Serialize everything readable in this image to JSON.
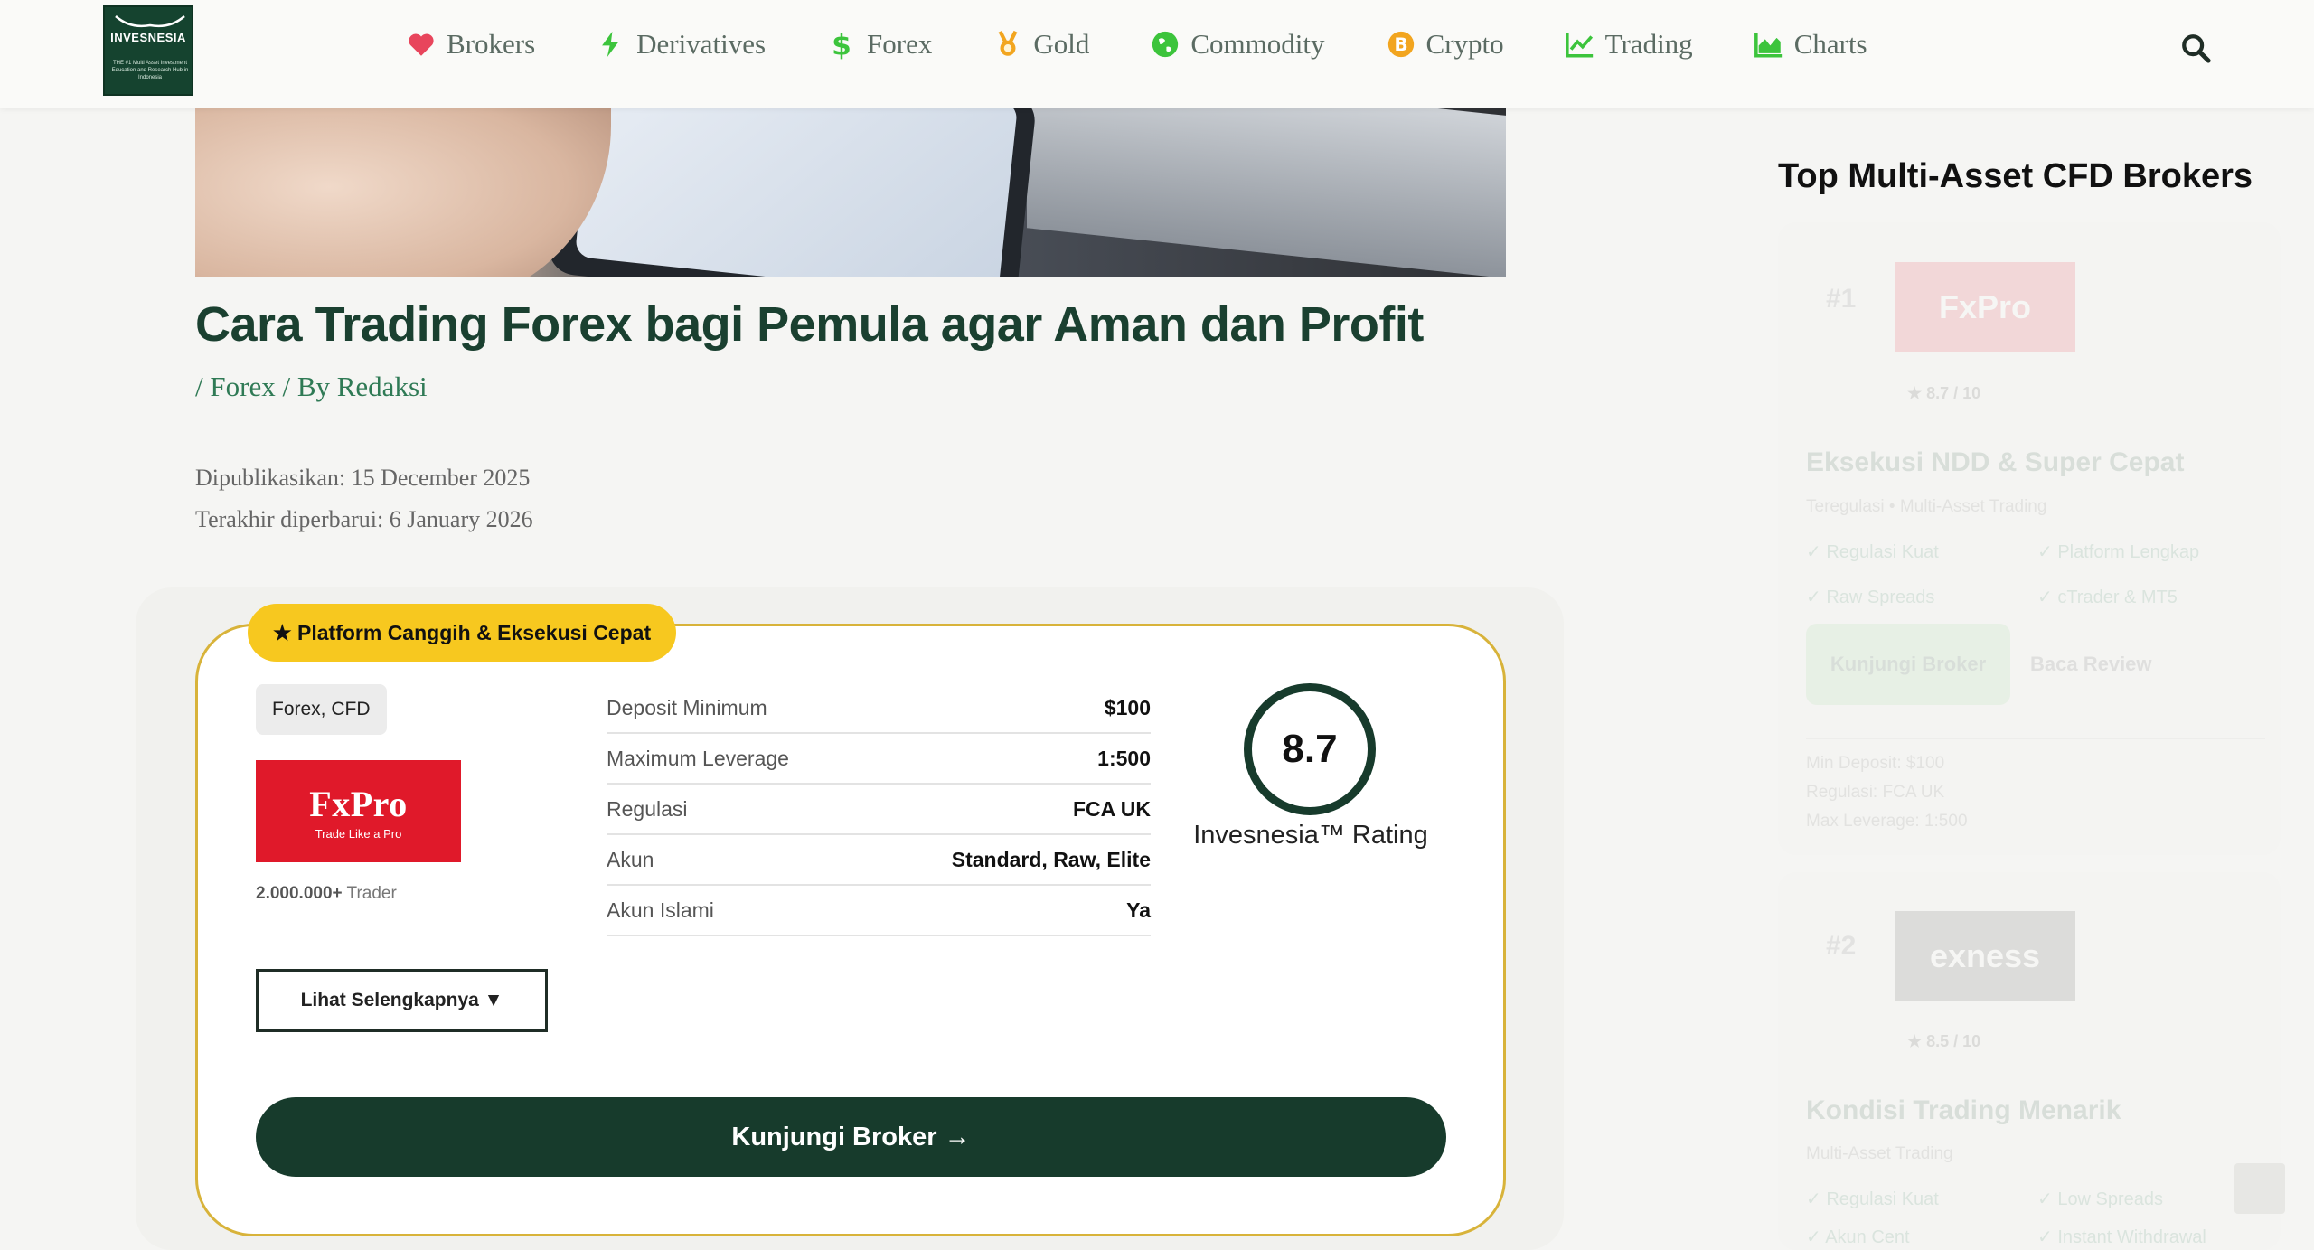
{
  "header": {
    "logo_text": "INVESNESIA",
    "logo_sub": "THE #1 Multi Asset Investment Education and Research Hub in Indonesia",
    "nav": [
      {
        "label": "Brokers",
        "icon": "heart-icon",
        "color": "#e8455c"
      },
      {
        "label": "Derivatives",
        "icon": "bolt-icon",
        "color": "#3cc43c"
      },
      {
        "label": "Forex",
        "icon": "dollar-icon",
        "color": "#3cc43c"
      },
      {
        "label": "Gold",
        "icon": "medal-icon",
        "color": "#f2a51f"
      },
      {
        "label": "Commodity",
        "icon": "globe-icon",
        "color": "#3cc43c"
      },
      {
        "label": "Crypto",
        "icon": "bitcoin-icon",
        "color": "#f2a51f"
      },
      {
        "label": "Trading",
        "icon": "line-chart-icon",
        "color": "#3cc43c"
      },
      {
        "label": "Charts",
        "icon": "area-chart-icon",
        "color": "#3cc43c"
      }
    ]
  },
  "article": {
    "title": "Cara Trading Forex bagi Pemula agar Aman dan Profit",
    "meta_prefix": "/ ",
    "category": "Forex",
    "meta_by": " / By ",
    "author": "Redaksi",
    "published": "Dipublikasikan: 15 December 2025",
    "updated": "Terakhir diperbarui: 6 January 2026"
  },
  "broker_card": {
    "badge": "★ Platform Canggih & Eksekusi Cepat",
    "tag": "Forex, CFD",
    "logo_name": "FxPro",
    "logo_tagline": "Trade Like a Pro",
    "traders_count": "2.000.000+",
    "traders_label": " Trader",
    "more_button": "Lihat Selengkapnya ▼",
    "specs": [
      {
        "label": "Deposit Minimum",
        "value": "$100"
      },
      {
        "label": "Maximum Leverage",
        "value": "1:500"
      },
      {
        "label": "Regulasi",
        "value": "FCA UK"
      },
      {
        "label": "Akun",
        "value": "Standard, Raw, Elite"
      },
      {
        "label": "Akun Islami",
        "value": "Ya"
      }
    ],
    "rating": "8.7",
    "rating_label": "Invesnesia™ Rating",
    "visit_button": "Kunjungi Broker →",
    "accent": "#d8b33a",
    "button_color": "#173b2c"
  },
  "sidebar": {
    "title": "Top Multi-Asset CFD Brokers",
    "brokers": [
      {
        "rank": "#1",
        "logo": "FxPro",
        "score": "★ 8.7 / 10",
        "headline": "Eksekusi NDD & Super Cepat",
        "sub": "Teregulasi • Multi-Asset Trading",
        "features": [
          "✓ Regulasi Kuat",
          "✓ Platform Lengkap",
          "✓ Raw Spreads",
          "✓ cTrader & MT5"
        ],
        "button": "Kunjungi Broker",
        "link": "Baca Review",
        "info": [
          "Min Deposit: $100",
          "Regulasi: FCA UK",
          "Max Leverage: 1:500"
        ]
      },
      {
        "rank": "#2",
        "logo": "exness",
        "score": "★ 8.5 / 10",
        "headline": "Kondisi Trading Menarik",
        "sub": "Multi-Asset Trading",
        "features": [
          "✓ Regulasi Kuat",
          "✓ Low Spreads",
          "✓ Akun Cent",
          "✓ Instant Withdrawal"
        ]
      }
    ]
  }
}
